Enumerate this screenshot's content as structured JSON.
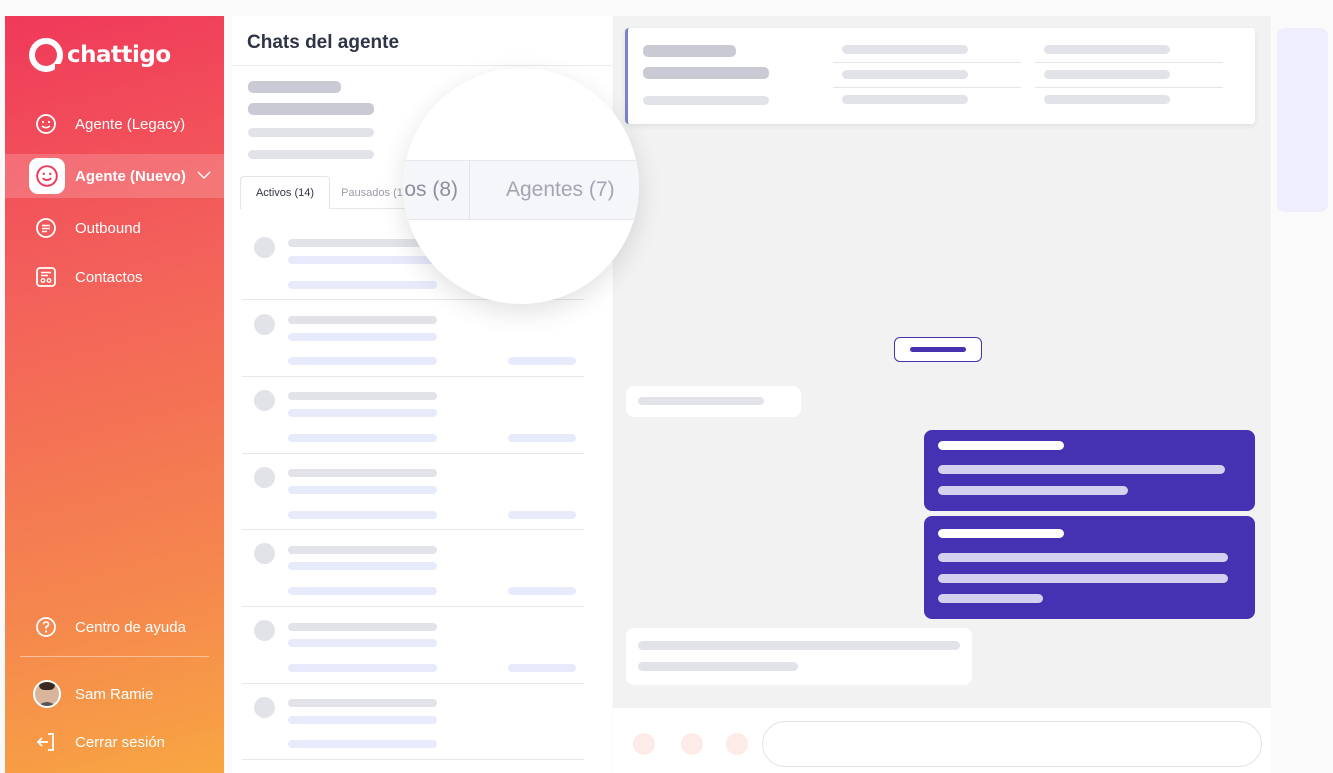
{
  "sidebar": {
    "brand": "chattigo",
    "items": [
      {
        "label": "Agente (Legacy)",
        "icon": "smiley-chat-icon"
      },
      {
        "label": "Agente (Nuevo)",
        "icon": "smiley-chat-icon",
        "active": true
      },
      {
        "label": "Outbound",
        "icon": "message-lines-icon"
      },
      {
        "label": "Contactos",
        "icon": "contact-card-icon"
      }
    ],
    "help_label": "Centro de ayuda",
    "user_name": "Sam Ramie",
    "logout_label": "Cerrar sesión",
    "gradient": [
      "#f0395a",
      "#f8a642"
    ]
  },
  "chat_list": {
    "title": "Chats del agente",
    "tabs": [
      {
        "label": "Activos (14)",
        "active": true
      },
      {
        "label": "Pausados (1",
        "active": false
      }
    ]
  },
  "magnifier": {
    "tab_partial": "os (8)",
    "tab_agents": "Agentes (7)"
  },
  "colors": {
    "accent": "#4532b3",
    "sidebar_start": "#f0395a",
    "sidebar_end": "#f8a642"
  }
}
